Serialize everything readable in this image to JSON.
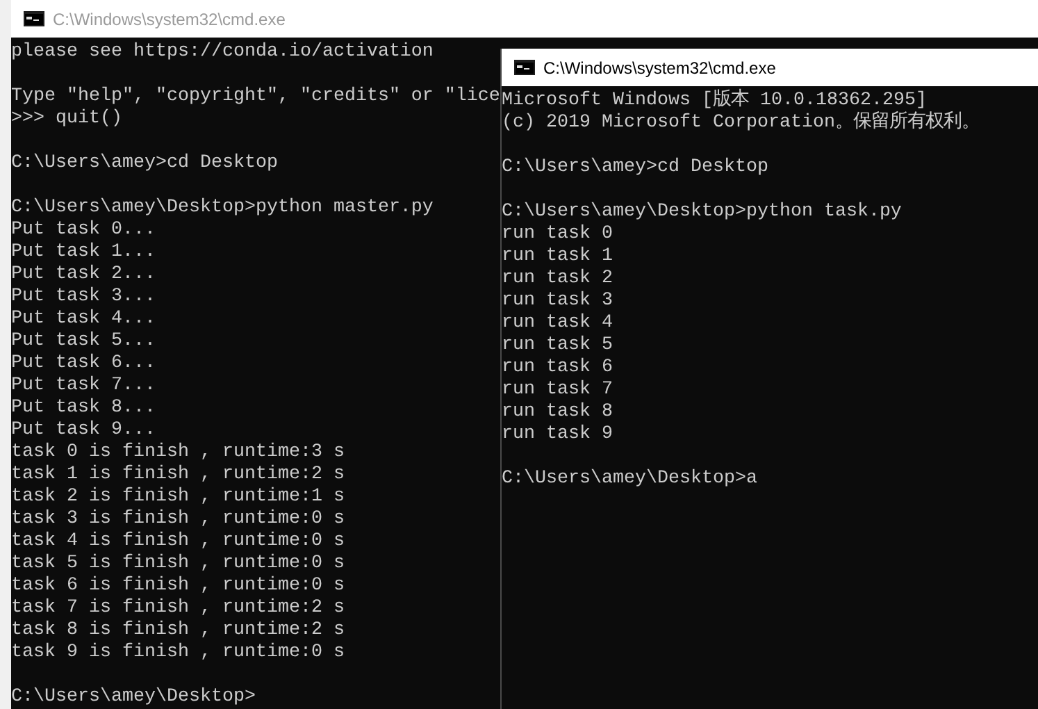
{
  "windows": [
    {
      "title": "C:\\Windows\\system32\\cmd.exe",
      "focused": false,
      "blocks": [
        [
          "please see https://conda.io/activation"
        ],
        [
          "Type \"help\", \"copyright\", \"credits\" or \"lice",
          ">>> quit()"
        ],
        [
          "C:\\Users\\amey>cd Desktop"
        ],
        [
          "C:\\Users\\amey\\Desktop>python master.py",
          "Put task 0...",
          "Put task 1...",
          "Put task 2...",
          "Put task 3...",
          "Put task 4...",
          "Put task 5...",
          "Put task 6...",
          "Put task 7...",
          "Put task 8...",
          "Put task 9...",
          "task 0 is finish , runtime:3 s",
          "task 1 is finish , runtime:2 s",
          "task 2 is finish , runtime:1 s",
          "task 3 is finish , runtime:0 s",
          "task 4 is finish , runtime:0 s",
          "task 5 is finish , runtime:0 s",
          "task 6 is finish , runtime:0 s",
          "task 7 is finish , runtime:2 s",
          "task 8 is finish , runtime:2 s",
          "task 9 is finish , runtime:0 s"
        ],
        [
          "C:\\Users\\amey\\Desktop>"
        ]
      ]
    },
    {
      "title": "C:\\Windows\\system32\\cmd.exe",
      "focused": true,
      "blocks": [
        [
          "Microsoft Windows [版本 10.0.18362.295]",
          "(c) 2019 Microsoft Corporation。保留所有权利。"
        ],
        [
          "C:\\Users\\amey>cd Desktop"
        ],
        [
          "C:\\Users\\amey\\Desktop>python task.py",
          "run task 0",
          "run task 1",
          "run task 2",
          "run task 3",
          "run task 4",
          "run task 5",
          "run task 6",
          "run task 7",
          "run task 8",
          "run task 9"
        ],
        [
          "C:\\Users\\amey\\Desktop>a"
        ]
      ]
    }
  ]
}
